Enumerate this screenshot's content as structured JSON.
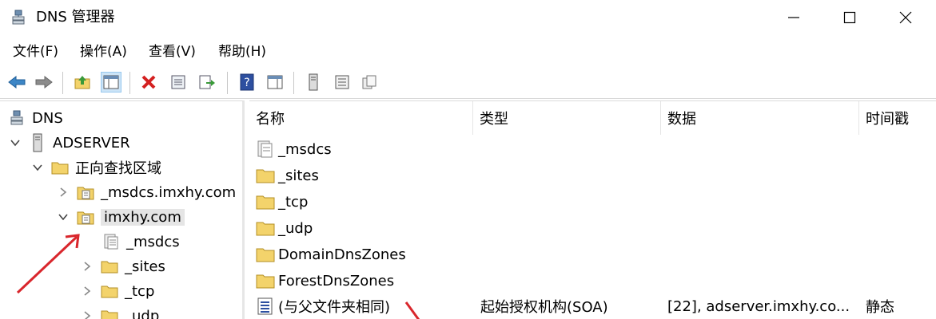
{
  "window": {
    "title": "DNS 管理器",
    "minimize_icon": "minimize-icon",
    "maximize_icon": "maximize-icon",
    "close_icon": "close-icon"
  },
  "menu": {
    "items": [
      {
        "label": "文件(F)"
      },
      {
        "label": "操作(A)"
      },
      {
        "label": "查看(V)"
      },
      {
        "label": "帮助(H)"
      }
    ]
  },
  "toolbar": {
    "buttons": [
      "back-arrow-icon",
      "forward-arrow-icon",
      "up-folder-icon",
      "show-hide-tree-icon",
      "delete-icon",
      "properties-icon",
      "export-list-icon",
      "help-icon",
      "action-pane-icon",
      "server-icon",
      "list-view-icon",
      "copy-icon"
    ]
  },
  "tree": {
    "root": "DNS",
    "server": "ADSERVER",
    "forward_zones": "正向查找区域",
    "zone_msdcs": "_msdcs.imxhy.com",
    "zone_selected": "imxhy.com",
    "sub_msdcs": "_msdcs",
    "sub_sites": "_sites",
    "sub_tcp": "_tcp",
    "sub_udp": "_udp"
  },
  "list": {
    "columns": {
      "name": "名称",
      "type": "类型",
      "data": "数据",
      "timestamp": "时间戳"
    },
    "rows": [
      {
        "name": "_msdcs",
        "type": "",
        "data": "",
        "timestamp": "",
        "icon": "delegated-zone-icon"
      },
      {
        "name": "_sites",
        "type": "",
        "data": "",
        "timestamp": "",
        "icon": "folder-icon"
      },
      {
        "name": "_tcp",
        "type": "",
        "data": "",
        "timestamp": "",
        "icon": "folder-icon"
      },
      {
        "name": "_udp",
        "type": "",
        "data": "",
        "timestamp": "",
        "icon": "folder-icon"
      },
      {
        "name": "DomainDnsZones",
        "type": "",
        "data": "",
        "timestamp": "",
        "icon": "folder-icon"
      },
      {
        "name": "ForestDnsZones",
        "type": "",
        "data": "",
        "timestamp": "",
        "icon": "folder-icon"
      },
      {
        "name": "(与父文件夹相同)",
        "type": "起始授权机构(SOA)",
        "data": "[22], adserver.imxhy.co...",
        "timestamp": "静态",
        "icon": "record-icon"
      }
    ]
  },
  "colors": {
    "annotation_arrow": "#d9262c",
    "folder": "#f3d36b",
    "selection": "#e5e5e5",
    "toolbar_active": "#cce4f7"
  }
}
